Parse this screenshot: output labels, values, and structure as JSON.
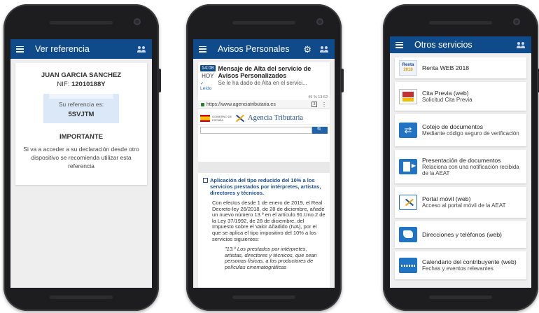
{
  "phone1": {
    "title": "Ver referencia",
    "name": "JUAN GARCIA SANCHEZ",
    "nif_label": "NIF: ",
    "nif_value": "12010188Y",
    "ref_label": "Su referencia es:",
    "ref_code": "5SVJTM",
    "important_title": "IMPORTANTE",
    "important_text": "Si va a acceder a su declaración desde otro dispositivo se recomienda utilizar esta referencia"
  },
  "phone2": {
    "title": "Avisos Personales",
    "notification": {
      "time": "14:08",
      "day": "HOY",
      "status": "Leído",
      "title": "Mensaje de Alta del servicio de Avisos Personalizados",
      "subtitle": "Se le ha dado de Alta en el servici..."
    },
    "browser": {
      "status": "49 % 13:52",
      "url": "https://www.agenciatributaria.es",
      "tabs": "3",
      "gov_text": "GOBIERNO DE ESPAÑA",
      "agency": "Agencia Tributaria",
      "search_button": "🔍"
    },
    "article": {
      "title": "Aplicación del tipo reducido del 10% a los servicios prestados por intérpretes, artistas, directores y técnicos.",
      "text": "Con efectos desde 1 de enero de 2019, el Real Decreto-ley 26/2018, de 28 de diciembre, añade un nuevo número 13.º en el artículo 91.Uno.2 de la Ley 37/1992, de 28 de diciembre, del Impuesto sobre el Valor Añadido (IVA), por el que se aplica el tipo impositivo del 10% a los servicios siguientes:",
      "quote": "\"13.º Los prestados por intérpretes, artistas, directores y técnicos, que sean personas físicas, a los productores de películas cinematográficas"
    }
  },
  "phone3": {
    "title": "Otros servicios",
    "services": [
      {
        "title": "Renta WEB 2018",
        "subtitle": "",
        "icon": "renta-icon",
        "icon_text_1": "Renta",
        "icon_text_2": "2018"
      },
      {
        "title": "Cita Previa (web)",
        "subtitle": "Solicitud Cita Previa",
        "icon": "cita-previa-icon"
      },
      {
        "title": "Cotejo de documentos",
        "subtitle": "Mediante código seguro de verificación",
        "icon": "swap-icon"
      },
      {
        "title": "Presentación de documentos",
        "subtitle": "Relaciona con una notificación recibida de la AEAT",
        "icon": "document-send-icon"
      },
      {
        "title": "Portal móvil (web)",
        "subtitle": "Acceso al portal móvil de la AEAT",
        "icon": "aeat-logo-icon"
      },
      {
        "title": "Direcciones y teléfonos (web)",
        "subtitle": "",
        "icon": "map-icon"
      },
      {
        "title": "Calendario del contribuyente (web)",
        "subtitle": "Fechas y eventos relevantes",
        "icon": "calendar-icon"
      }
    ]
  },
  "colors": {
    "appbar": "#0f4a8a",
    "accent": "#2174c3"
  }
}
